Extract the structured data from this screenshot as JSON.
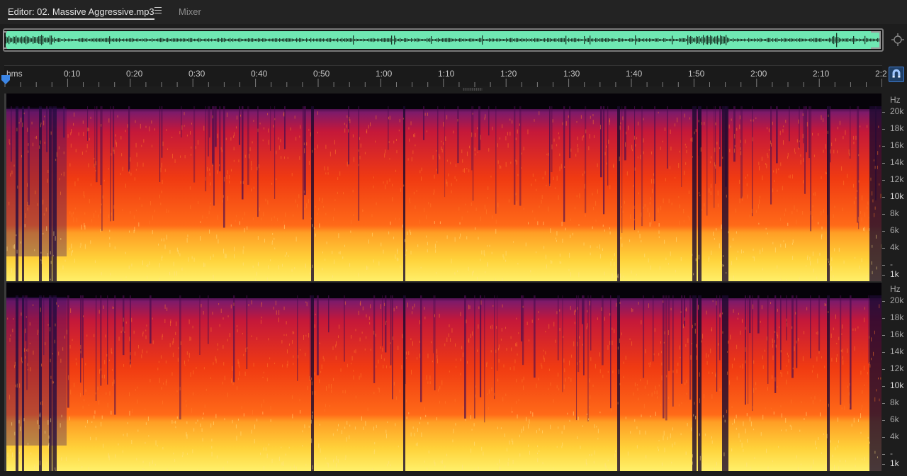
{
  "tabs": {
    "editor_label": "Editor: 02. Massive Aggressive.mp3",
    "mixer_label": "Mixer"
  },
  "icons": {
    "panel_menu": "hamburger-menu-icon",
    "zoom": "zoom-crosshair-icon",
    "snap": "magnet-icon",
    "playhead": "playhead-marker-icon"
  },
  "colors": {
    "overview_waveform": "#6fe8b3",
    "snap_active": "#3f7bd0",
    "spectrum_low": "#ffd23a",
    "spectrum_mid": "#ff5a14",
    "spectrum_high": "#b8104a",
    "spectrum_floor": "#3a1060"
  },
  "ruler": {
    "unit_label": "hms",
    "labels": [
      "0:10",
      "0:20",
      "0:30",
      "0:40",
      "0:50",
      "1:00",
      "1:10",
      "1:20",
      "1:30",
      "1:40",
      "1:50",
      "2:00",
      "2:10",
      "2:2"
    ]
  },
  "freq_axis": {
    "unit": "Hz",
    "labels": [
      "20k",
      "18k",
      "16k",
      "14k",
      "12k",
      "10k",
      "8k",
      "6k",
      "4k",
      "-",
      "1k"
    ],
    "major": [
      "10k",
      "1k"
    ]
  }
}
